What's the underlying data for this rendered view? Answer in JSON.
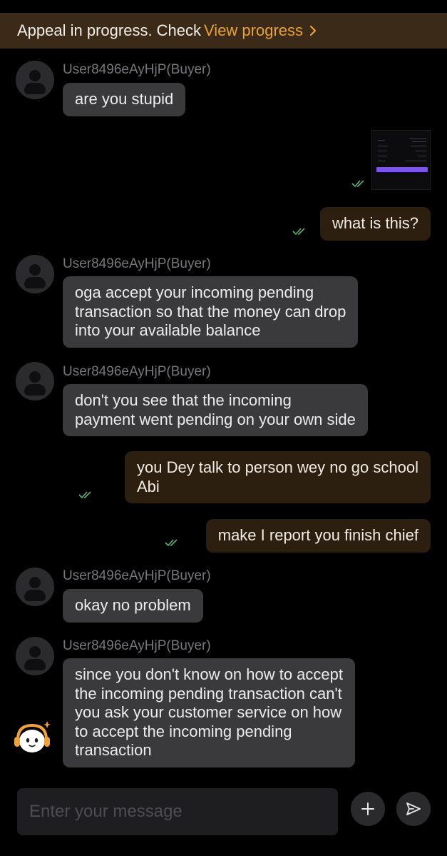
{
  "banner": {
    "text": "Appeal in progress. Check",
    "link": "View progress"
  },
  "messages": {
    "m1": {
      "sender": "User8496eAyHjP(Buyer)",
      "text": "are you stupid"
    },
    "m3": {
      "text": "what is this?"
    },
    "m4": {
      "sender": "User8496eAyHjP(Buyer)",
      "text": "oga accept your incoming pending\ntransaction so that the money can drop\ninto your available balance"
    },
    "m5": {
      "sender": "User8496eAyHjP(Buyer)",
      "text": "don't you see that the incoming\npayment went pending on your own side"
    },
    "m6": {
      "text": "you Dey talk to person wey no go school\nAbi"
    },
    "m7": {
      "text": "make I report you finish chief"
    },
    "m8": {
      "sender": "User8496eAyHjP(Buyer)",
      "text": "okay no problem"
    },
    "m9": {
      "sender": "User8496eAyHjP(Buyer)",
      "text": "since you don't know on how to accept\nthe incoming pending transaction can't\nyou ask your customer service on how\nto accept the incoming pending\ntransaction"
    }
  },
  "composer": {
    "placeholder": "Enter your message"
  },
  "colors": {
    "banner_bg": "#3a2a17",
    "link": "#e9a13a",
    "incoming_bubble": "#3a3a3d",
    "outgoing_bubble": "#2c1f0f",
    "read_check": "#5fb37a",
    "thumb_button": "#7b56e8"
  },
  "icons": {
    "chevron": "chevron-right-icon",
    "check": "double-check-icon",
    "plus": "plus-icon",
    "send": "send-icon",
    "mascot": "support-mascot-icon"
  }
}
